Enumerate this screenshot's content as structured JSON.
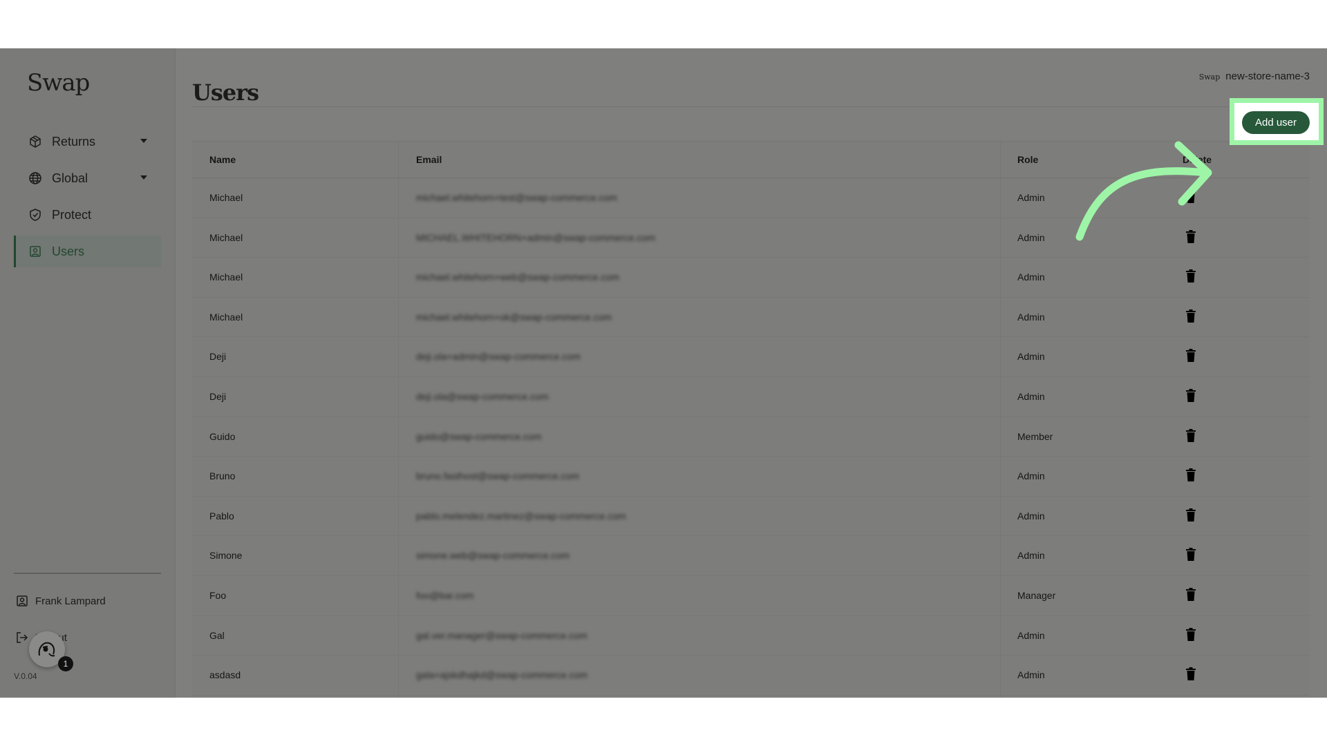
{
  "app": {
    "logo": "Swap",
    "version": "V.0.04"
  },
  "sidebar": {
    "items": [
      {
        "label": "Returns",
        "icon": "box-icon",
        "expandable": true
      },
      {
        "label": "Global",
        "icon": "globe-icon",
        "expandable": true
      },
      {
        "label": "Protect",
        "icon": "shield-icon",
        "expandable": false
      },
      {
        "label": "Users",
        "icon": "user-badge-icon",
        "active": true
      }
    ],
    "user_name": "Frank Lampard",
    "logout_label": "Logout",
    "notification_count": "1"
  },
  "header": {
    "title": "Users",
    "store_logo": "Swap",
    "store_name": "new-store-name-3",
    "add_user_label": "Add user"
  },
  "table": {
    "columns": [
      "Name",
      "Email",
      "Role",
      "Delete"
    ],
    "rows": [
      {
        "name": "Michael",
        "email": "michael.whitehorn+test@swap-commerce.com",
        "role": "Admin"
      },
      {
        "name": "Michael",
        "email": "MICHAEL.WHITEHORN+admin@swap-commerce.com",
        "role": "Admin"
      },
      {
        "name": "Michael",
        "email": "michael.whitehorn+web@swap-commerce.com",
        "role": "Admin"
      },
      {
        "name": "Michael",
        "email": "michael.whitehorn+ok@swap-commerce.com",
        "role": "Admin"
      },
      {
        "name": "Deji",
        "email": "deji.ola+admin@swap-commerce.com",
        "role": "Admin"
      },
      {
        "name": "Deji",
        "email": "deji.ola@swap-commerce.com",
        "role": "Admin"
      },
      {
        "name": "Guido",
        "email": "guido@swap-commerce.com",
        "role": "Member"
      },
      {
        "name": "Bruno",
        "email": "bruno.fasthost@swap-commerce.com",
        "role": "Admin"
      },
      {
        "name": "Pablo",
        "email": "pablo.melendez.martinez@swap-commerce.com",
        "role": "Admin"
      },
      {
        "name": "Simone",
        "email": "simone.web@swap-commerce.com",
        "role": "Admin"
      },
      {
        "name": "Foo",
        "email": "foo@bar.com",
        "role": "Manager"
      },
      {
        "name": "Gal",
        "email": "gal.ver.manager@swap-commerce.com",
        "role": "Admin"
      },
      {
        "name": "asdasd",
        "email": "gala+ajskdhajkd@swap-commerce.com",
        "role": "Admin"
      }
    ]
  },
  "colors": {
    "accent": "#27583a",
    "highlight": "#9ef5a7",
    "overlay": "#7f7f7d"
  }
}
